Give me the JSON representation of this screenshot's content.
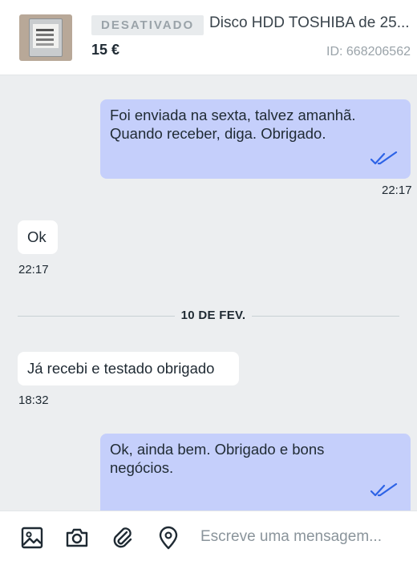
{
  "listing": {
    "status_badge": "DESATIVADO",
    "title": "Disco HDD TOSHIBA de 25...",
    "price": "15 €",
    "id_text": "ID: 668206562"
  },
  "messages": [
    {
      "direction": "outgoing",
      "lines": [
        "Foi enviada na sexta, talvez amanhã.",
        "Quando receber, diga. Obrigado."
      ],
      "time": "22:17",
      "read": true
    },
    {
      "direction": "incoming",
      "lines": [
        "Ok"
      ],
      "time": "22:17"
    },
    {
      "direction": "incoming",
      "lines": [
        "Já recebi e testado obrigado"
      ],
      "time": "18:32"
    },
    {
      "direction": "outgoing",
      "lines": [
        "Ok, ainda bem. Obrigado e bons",
        "negócios."
      ],
      "read": true
    }
  ],
  "date_divider": "10 DE FEV.",
  "composer": {
    "placeholder": "Escreve uma mensagem...",
    "tools": [
      "image-icon",
      "camera-icon",
      "paperclip-icon",
      "location-pin-icon"
    ]
  },
  "colors": {
    "outgoing_bubble": "#c5cffb",
    "incoming_bubble": "#ffffff",
    "background": "#eceef0",
    "read_check": "#2d63e6"
  }
}
